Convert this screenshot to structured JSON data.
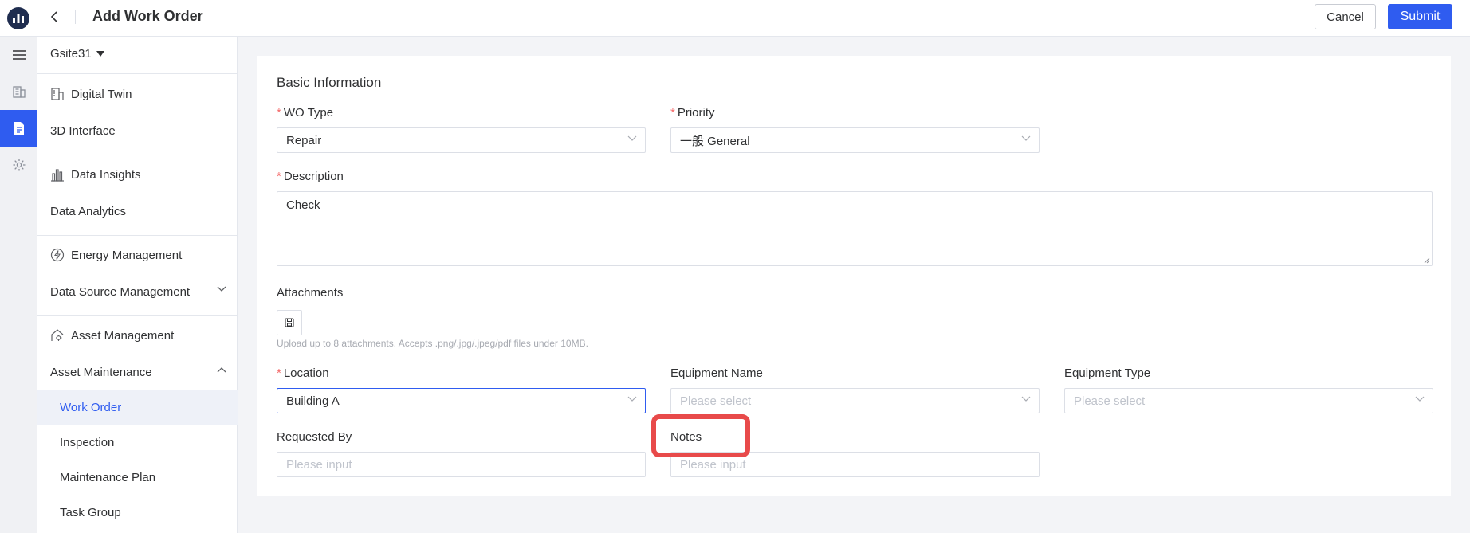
{
  "header": {
    "title": "Add Work Order",
    "cancel_label": "Cancel",
    "submit_label": "Submit"
  },
  "rail": {
    "items": [
      "menu-icon",
      "building-icon",
      "document-icon",
      "gear-icon"
    ],
    "active_index": 2
  },
  "sidenav": {
    "site": "Gsite31",
    "groups": [
      {
        "label": "Digital Twin",
        "icon": "building-chart-icon",
        "items": [
          "3D Interface"
        ]
      },
      {
        "label": "Data Insights",
        "icon": "bar-chart-icon",
        "items": [
          "Data Analytics"
        ]
      },
      {
        "label": "Energy Management",
        "icon": "energy-icon",
        "items": [
          "Data Source Management"
        ]
      },
      {
        "label": "Asset Management",
        "icon": "house-gear-icon",
        "items": [
          "Asset Maintenance",
          "Work Order",
          "Inspection",
          "Maintenance Plan",
          "Task Group"
        ]
      }
    ],
    "active_item": "Work Order"
  },
  "form": {
    "section_title": "Basic Information",
    "wo_type": {
      "label": "WO Type",
      "value": "Repair"
    },
    "priority": {
      "label": "Priority",
      "value": "一般 General"
    },
    "description": {
      "label": "Description",
      "value": "Check"
    },
    "attachments": {
      "label": "Attachments",
      "hint": "Upload up to 8 attachments. Accepts .png/.jpg/.jpeg/pdf files under 10MB."
    },
    "location": {
      "label": "Location",
      "value": "Building A"
    },
    "equipment_name": {
      "label": "Equipment Name",
      "placeholder": "Please select"
    },
    "equipment_type": {
      "label": "Equipment Type",
      "placeholder": "Please select"
    },
    "requested_by": {
      "label": "Requested By",
      "placeholder": "Please input"
    },
    "notes": {
      "label": "Notes",
      "placeholder": "Please input"
    },
    "required_mark": "*"
  },
  "colors": {
    "accent": "#2f5cf0",
    "required": "#f56c6c",
    "highlight": "#e84a4a"
  }
}
